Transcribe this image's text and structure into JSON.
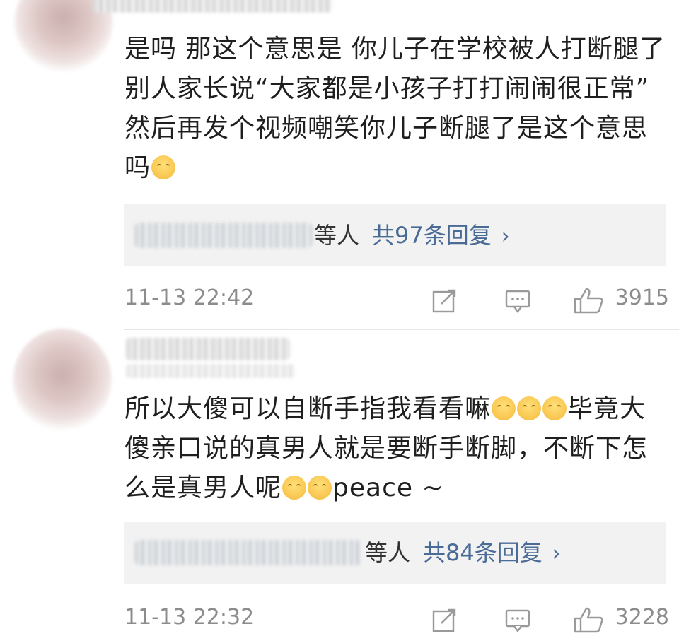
{
  "comments": [
    {
      "text": "是吗 那这个意思是 你儿子在学校被人打断腿了  别人家长说“大家都是小孩子打打闹闹很正常” 然后再发个视频嘲笑你儿子断腿了是这个意思吗",
      "emoji_icons": [
        "smiling-face-with-hands-icon"
      ],
      "replies": {
        "suffix": "等人",
        "count_label": "共97条回复",
        "chevron": "›"
      },
      "time": "11-13 22:42",
      "likes": "3915"
    },
    {
      "text": "所以大傻可以自断手指我看看嘛",
      "text_2": "毕竟大傻亲口说的真男人就是要断手断脚，不断下怎么是真男人呢",
      "text_3": "peace ~",
      "emoji_icons": [
        "smile-icon",
        "smile-icon",
        "smile-icon",
        "pleading-face-icon",
        "scared-face-icon"
      ],
      "replies": {
        "suffix": "等人",
        "count_label": "共84条回复",
        "chevron": "›"
      },
      "time": "11-13 22:32",
      "likes": "3228"
    }
  ],
  "icons": {
    "share": "share-icon",
    "comment": "comment-icon",
    "like": "thumbs-up-icon"
  },
  "colors": {
    "link": "#4a6b96",
    "meta": "#8c8c8c",
    "reply_bg": "#f2f2f2"
  }
}
